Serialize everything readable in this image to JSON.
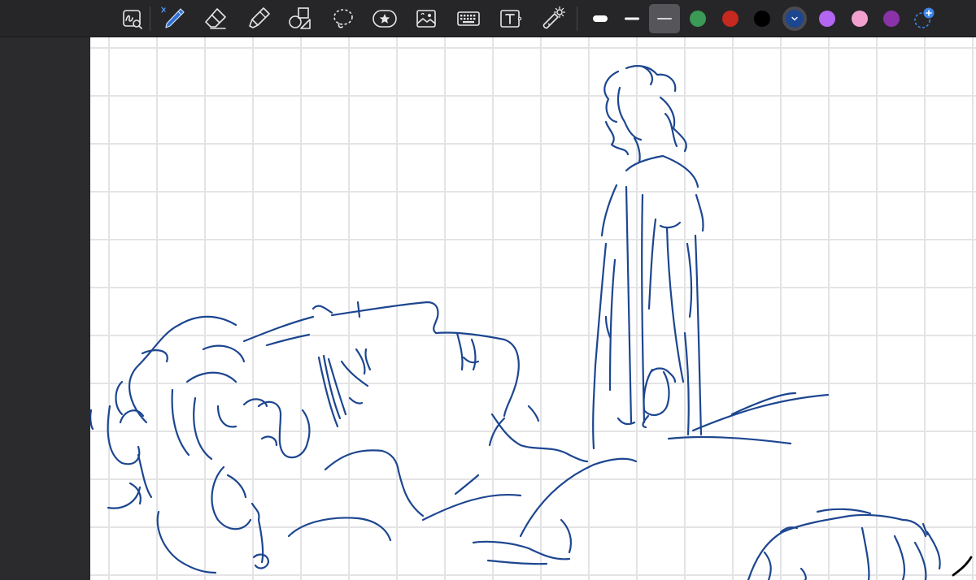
{
  "toolbar": {
    "tools": [
      {
        "name": "zoom-window-icon",
        "selected": false
      },
      {
        "name": "pen-icon",
        "selected": true
      },
      {
        "name": "eraser-icon",
        "selected": false
      },
      {
        "name": "highlighter-icon",
        "selected": false
      },
      {
        "name": "shapes-icon",
        "selected": false
      },
      {
        "name": "lasso-icon",
        "selected": false
      },
      {
        "name": "sticker-icon",
        "selected": false
      },
      {
        "name": "image-icon",
        "selected": false
      },
      {
        "name": "keyboard-icon",
        "selected": false
      },
      {
        "name": "text-box-icon",
        "selected": false
      },
      {
        "name": "laser-pointer-icon",
        "selected": false
      }
    ],
    "thicknesses": [
      "thick",
      "medium",
      "thin"
    ],
    "selected_thickness": "thin",
    "colors": [
      "#3a9a56",
      "#c5291f",
      "#000000",
      "#1d4690",
      "#b366f2",
      "#f2a1cf",
      "#8a33a8"
    ],
    "selected_color": "#1d4690",
    "add_color": "add-color-icon"
  },
  "canvas": {
    "paper": "grid",
    "ink_color": "#1d4690"
  }
}
